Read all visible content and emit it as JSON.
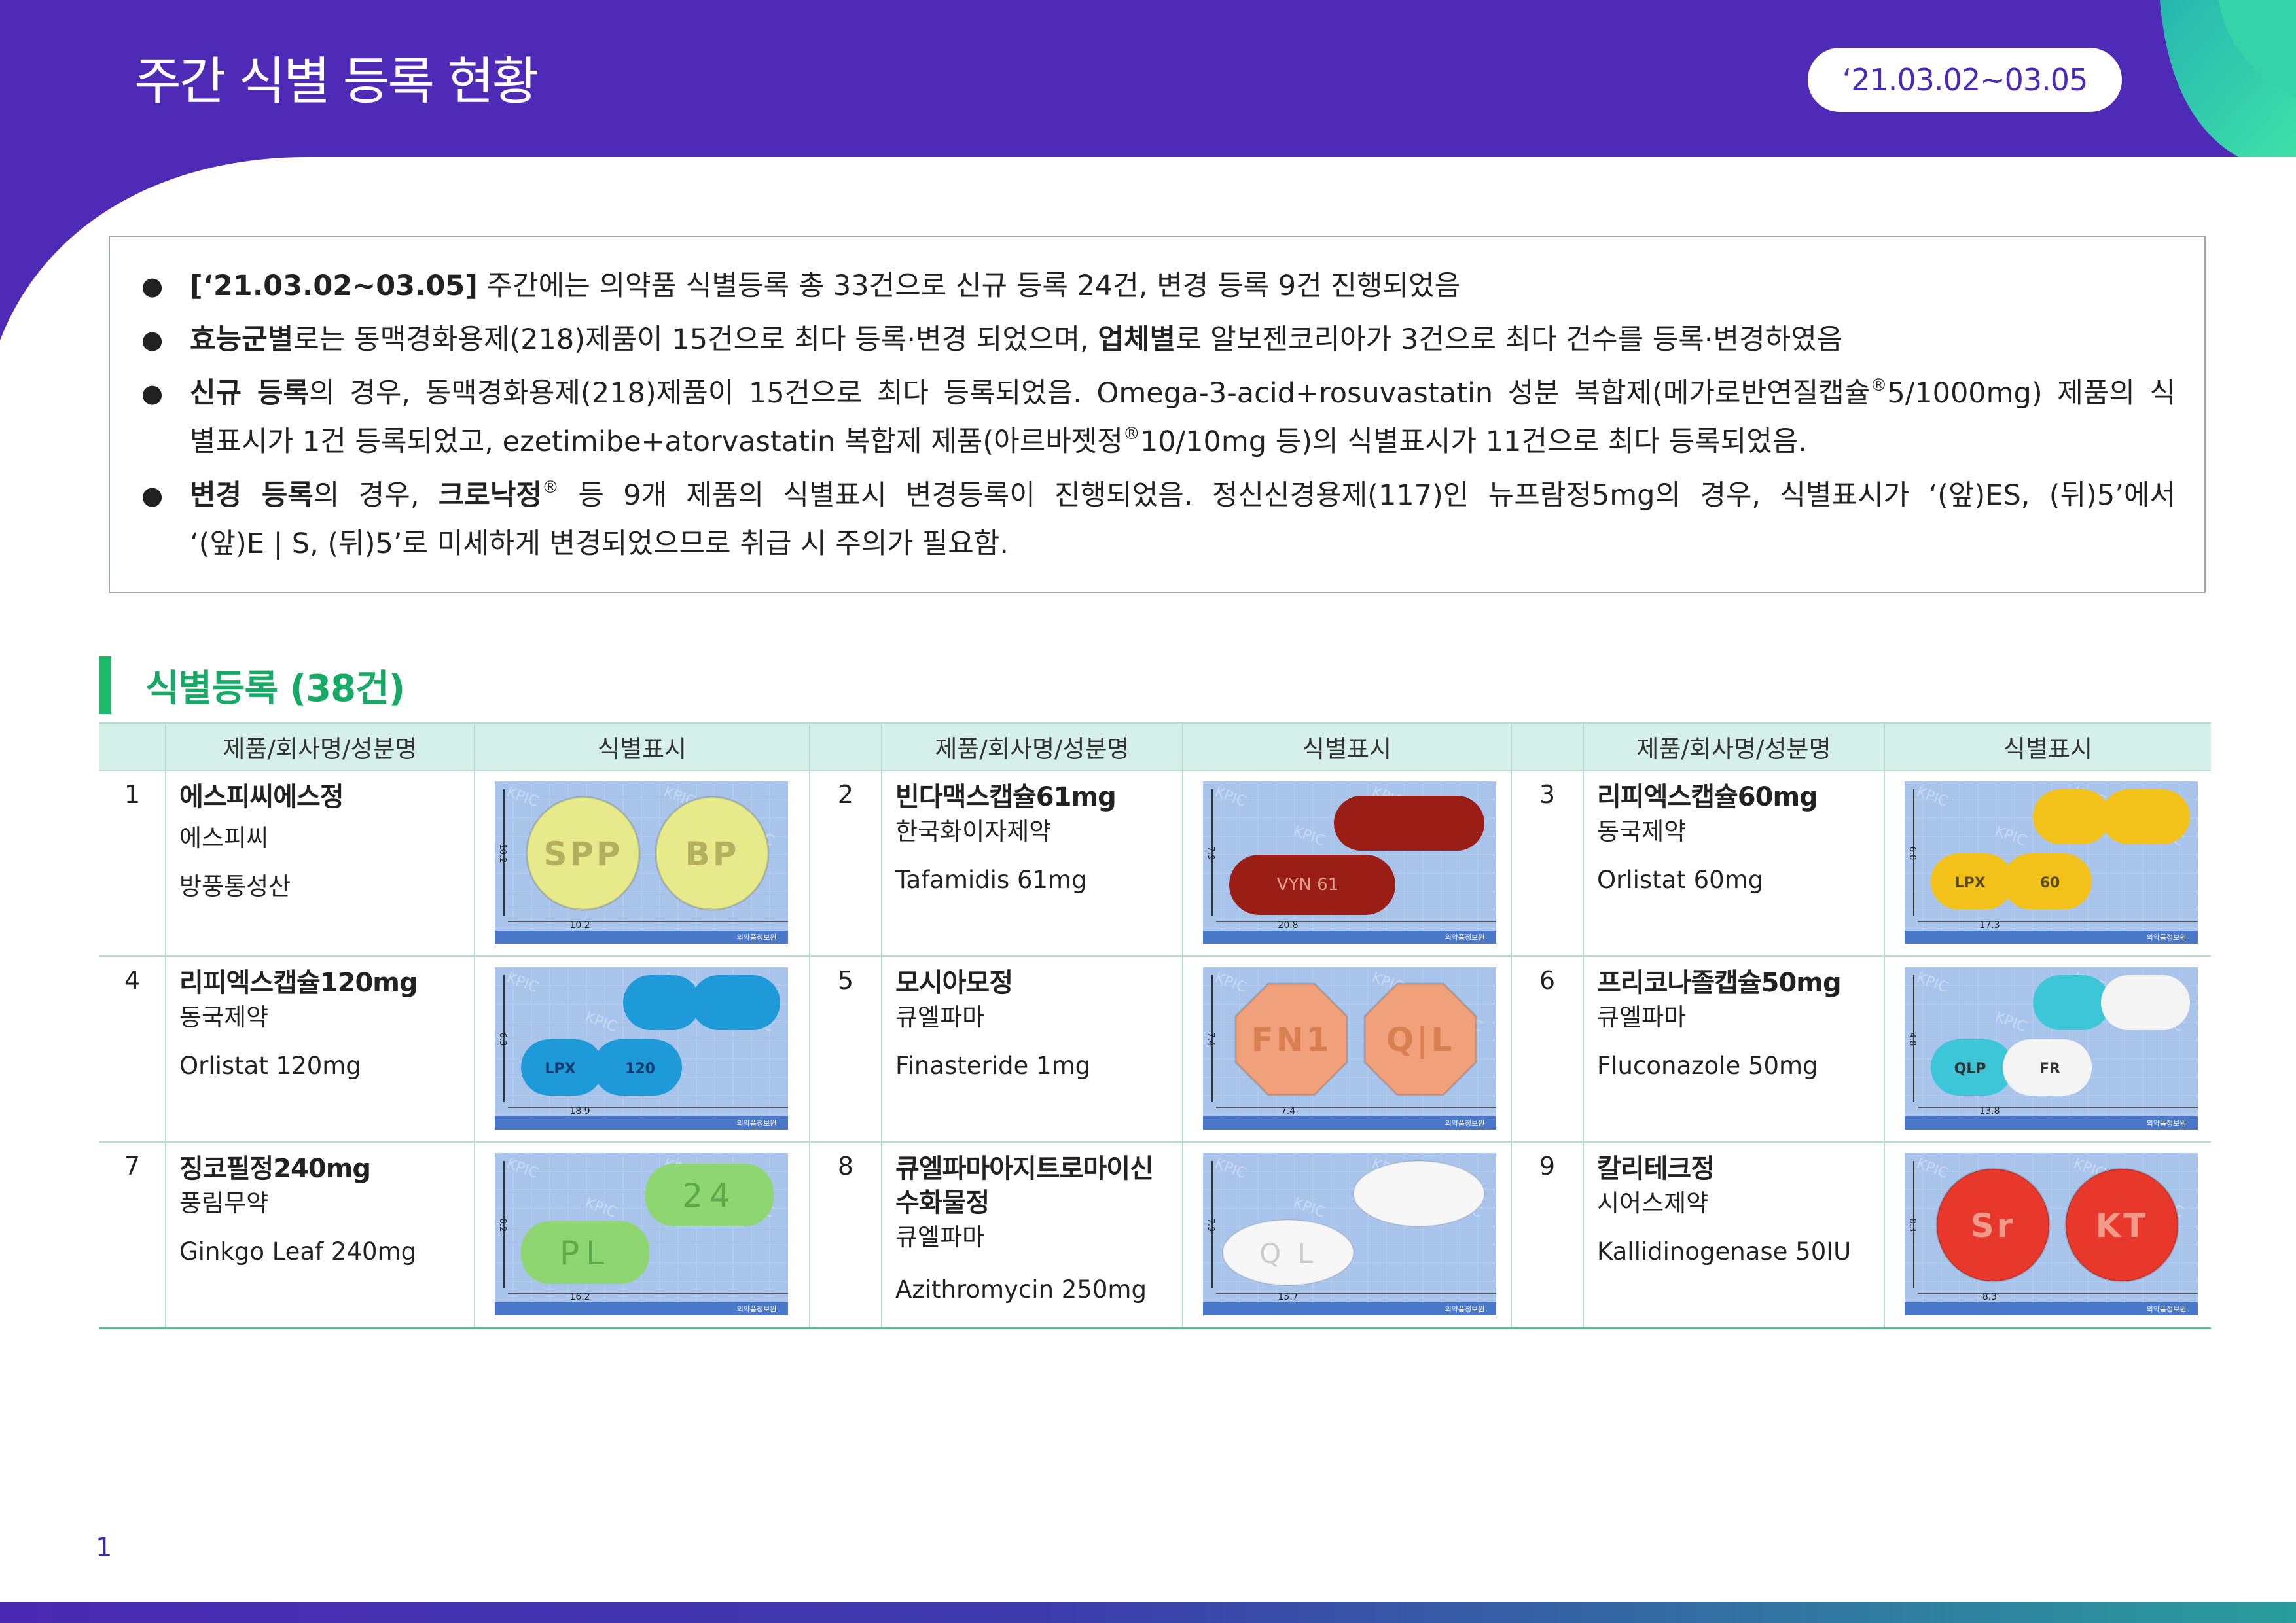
{
  "header": {
    "title": "주간 식별 등록 현황",
    "date_range": "‘21.03.02~03.05",
    "colors": {
      "band": "#4f2ab6",
      "accent_teal": "#2ec4a0"
    }
  },
  "summary": {
    "b1": {
      "bold": "[‘21.03.02~03.05]",
      "rest": " 주간에는 의약품 식별등록 총 33건으로 신규 등록 24건, 변경 등록 9건 진행되었음"
    },
    "b2": {
      "bold1": "효능군별",
      "mid": "로는 동맥경화용제(218)제품이 15건으로 최다 등록·변경 되었으며, ",
      "bold2": "업체별",
      "rest": "로 알보젠코리아가 3건으로 최다 건수를 등록·변경하였음"
    },
    "b3": {
      "bold": "신규 등록",
      "line1": "의 경우, 동맥경화용제(218)제품이 15건으로 최다 등록되었음. Omega-3-acid+rosuvastatin 성분 복합제(메가로반연질캡슐",
      "sup": "®",
      "line1b": "5/1000mg) 제품의 식",
      "line2": "별표시가 1건 등록되었고, ezetimibe+atorvastatin 복합제 제품(아르바젯정",
      "line2b": "10/10mg 등)의 식별표시가 11건으로 최다 등록되었음."
    },
    "b4": {
      "bold1": "변경 등록",
      "line1a": "의 경우, ",
      "bold2": "크로낙정",
      "line1b": " 등 9개 제품의 식별표시 변경등록이 진행되었음. 정신신경용제(117)인 뉴프람정5mg의 경우, 식별표시가 ‘(앞)ES, (뒤)5’에서",
      "line2": "‘(앞)E | S, (뒤)5’로 미세하게 변경되었으므로 취급 시 주의가 필요함."
    }
  },
  "section": {
    "title": "식별등록 (38건)",
    "color": "#17aa66"
  },
  "table": {
    "headers": {
      "product": "제품/회사명/성분명",
      "marking": "식별표시"
    },
    "items": [
      {
        "no": "1",
        "name": "에스피씨에스정",
        "company": "에스피씨",
        "ingredient": "방풍통성산",
        "image": {
          "shape": "round",
          "color": "#e6ea8a",
          "mark_front": "SPP",
          "mark_back": "BP",
          "height_label": "10.2",
          "width_label": "10.2"
        }
      },
      {
        "no": "2",
        "name": "빈다맥스캡슐61mg",
        "company": "한국화이자제약",
        "ingredient": "Tafamidis 61mg",
        "image": {
          "shape": "softgel",
          "color": "#9a1e16",
          "mark_front": "VYN 61",
          "mark_back": "",
          "height_label": "7.9",
          "width_label": "20.8"
        }
      },
      {
        "no": "3",
        "name": "리피엑스캡슐60mg",
        "company": "동국제약",
        "ingredient": "Orlistat 60mg",
        "image": {
          "shape": "capsule",
          "color": "#f2c21a",
          "mark_front": "LPX",
          "mark_back": "60",
          "height_label": "6.0",
          "width_label": "17.3"
        }
      },
      {
        "no": "4",
        "name": "리피엑스캡슐120mg",
        "company": "동국제약",
        "ingredient": "Orlistat 120mg",
        "image": {
          "shape": "capsule",
          "color": "#1e9ad8",
          "mark_front": "LPX",
          "mark_back": "120",
          "height_label": "6.3",
          "width_label": "18.9"
        }
      },
      {
        "no": "5",
        "name": "모시아모정",
        "company": "큐엘파마",
        "ingredient": "Finasteride 1mg",
        "image": {
          "shape": "octagon",
          "color": "#f0a07a",
          "mark_front": "FN1",
          "mark_back": "Q|L",
          "height_label": "7.4",
          "width_label": "7.4"
        }
      },
      {
        "no": "6",
        "name": "프리코나졸캡슐50mg",
        "company": "큐엘파마",
        "ingredient": "Fluconazole 50mg",
        "image": {
          "shape": "capsule2",
          "color": "#3cc6d8",
          "mark_front": "QLP",
          "mark_back": "FR",
          "height_label": "4.8",
          "width_label": "13.8"
        }
      },
      {
        "no": "7",
        "name": "징코필정240mg",
        "company": "풍림무약",
        "ingredient": "Ginkgo Leaf 240mg",
        "image": {
          "shape": "oblong",
          "color": "#8ed672",
          "mark_front": "PL",
          "mark_back": "24",
          "height_label": "8.2",
          "width_label": "16.2"
        }
      },
      {
        "no": "8",
        "name": "큐엘파마아지트로마이신수화물정",
        "name_line1": "큐엘파마아지트로마이신",
        "name_line2": "수화물정",
        "company": "큐엘파마",
        "ingredient": "Azithromycin 250mg",
        "image": {
          "shape": "oval",
          "color": "#f6f6f6",
          "mark_front": "Q L",
          "mark_back": "",
          "height_label": "7.9",
          "width_label": "15.7"
        }
      },
      {
        "no": "9",
        "name": "칼리테크정",
        "company": "시어스제약",
        "ingredient": "Kallidinogenase 50IU",
        "image": {
          "shape": "round",
          "color": "#e8382c",
          "mark_front": "Sr",
          "mark_back": "KT",
          "height_label": "8.3",
          "width_label": "8.3"
        }
      }
    ]
  },
  "footer": {
    "page_number": "1"
  }
}
